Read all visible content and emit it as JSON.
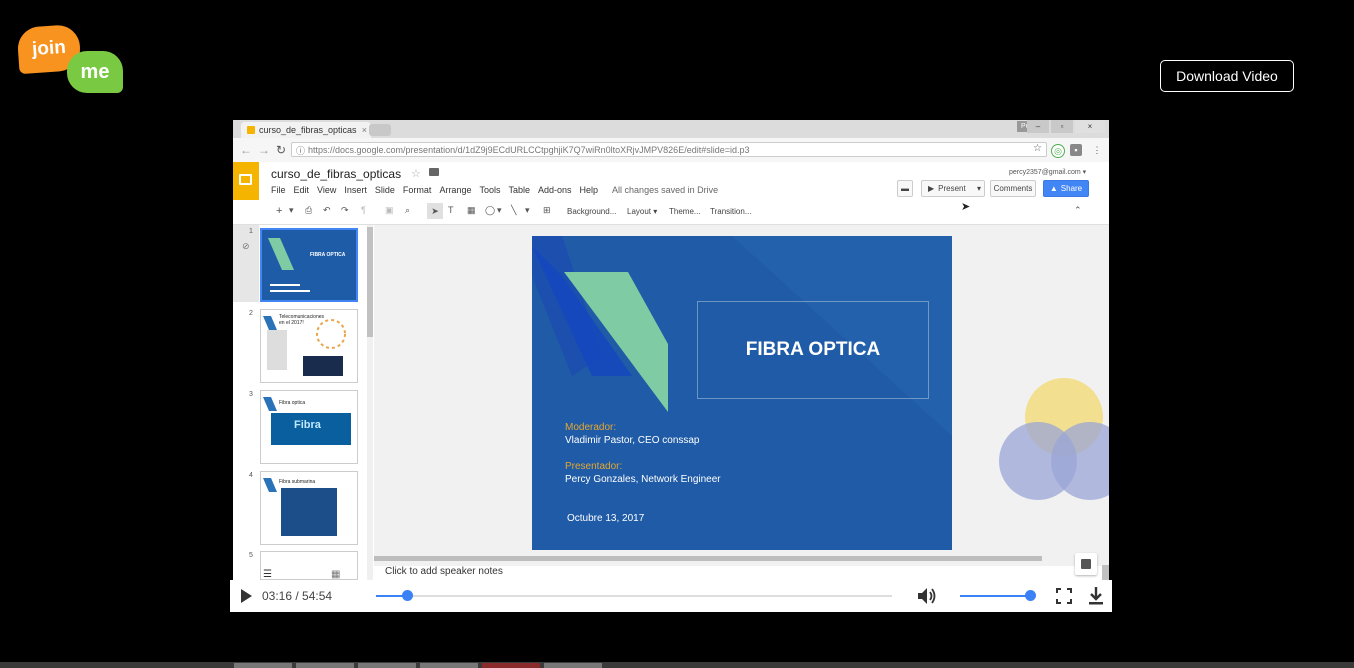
{
  "header": {
    "logo_top": "join",
    "logo_bottom": "me",
    "download_label": "Download Video"
  },
  "browser": {
    "tab_title": "curso_de_fibras_opticas",
    "profile_name": "Percy",
    "win_min": "–",
    "win_max": "▫",
    "win_close": "×",
    "url": "https://docs.google.com/presentation/d/1dZ9j9ECdURLCCtpghjiK7Q7wiRn0ltoXRjvJMPV826E/edit#slide=id.p3"
  },
  "docs": {
    "title": "curso_de_fibras_opticas",
    "menus": [
      "File",
      "Edit",
      "View",
      "Insert",
      "Slide",
      "Format",
      "Arrange",
      "Tools",
      "Table",
      "Add-ons",
      "Help"
    ],
    "saved_status": "All changes saved in Drive",
    "email": "percy2357@gmail.com",
    "present_label": "Present",
    "comments_label": "Comments",
    "share_label": "Share",
    "toolbar": {
      "background": "Background...",
      "layout": "Layout",
      "theme": "Theme...",
      "transition": "Transition..."
    }
  },
  "thumbnails": [
    {
      "num": "1",
      "title": "FIBRA OPTICA"
    },
    {
      "num": "2",
      "title": "Telecomunicaciones en el 2017!"
    },
    {
      "num": "3",
      "title": "Fibra optica",
      "inner": "Fibra"
    },
    {
      "num": "4",
      "title": "Fibra submarina"
    },
    {
      "num": "5"
    }
  ],
  "slide": {
    "title": "FIBRA OPTICA",
    "moderator_label": "Moderador:",
    "moderator_name": "Vladimir Pastor, CEO conssap",
    "presenter_label": "Presentador:",
    "presenter_name": "Percy Gonzales, Network Engineer",
    "date": "Octubre 13, 2017"
  },
  "notes_placeholder": "Click to add speaker notes",
  "player": {
    "current_time": "03:16",
    "duration": "54:54",
    "progress_fraction": 0.06,
    "volume_fraction": 1.0
  },
  "colors": {
    "slide_bg": "#1f5ba7",
    "accent_blue": "#3b82f6",
    "logo_orange": "#f7931e",
    "logo_green": "#7ac943",
    "docs_yellow": "#f4b400"
  }
}
